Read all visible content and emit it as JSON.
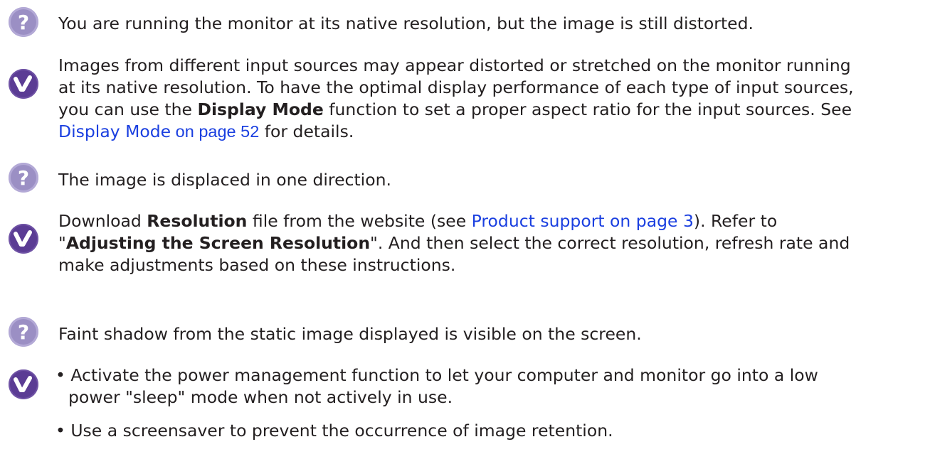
{
  "qa": [
    {
      "question": "You are running the monitor at its native resolution, but the image is still distorted.",
      "answer": {
        "line1": "Images from different input sources may appear distorted or stretched on the monitor running",
        "line2": "at its native resolution. To have the optimal display performance of each type of input sources,",
        "line3_pre": "you can use the ",
        "line3_bold": "Display Mode",
        "line3_post": " function to set a proper aspect ratio for the input sources. See",
        "link_text": "Display Mode",
        "link_page": " on page 52",
        "line4_post": " for details."
      }
    },
    {
      "question": "The image is displaced in one direction.",
      "answer": {
        "line1_pre": "Download ",
        "line1_bold": "Resolution",
        "line1_mid": " file from the website (see ",
        "link_text": "Product support on page 3",
        "line1_post": "). Refer to",
        "line2_pre": "\"",
        "line2_bold": "Adjusting the Screen Resolution",
        "line2_post": "\". And then select the correct resolution, refresh rate and",
        "line3": "make adjustments based on these instructions."
      }
    },
    {
      "question": "Faint shadow from the static image displayed is visible on the screen.",
      "answer": {
        "bullet": "•",
        "bullet1_line1": "Activate the power management function to let your computer and monitor go into a low",
        "bullet1_line2": "power \"sleep\" mode when not actively in use.",
        "bullet2": "Use a screensaver to prevent the occurrence of image retention."
      }
    }
  ],
  "colors": {
    "question_icon": "#9b8fc4",
    "answer_icon": "#5b3c94",
    "link": "#1a3fe0",
    "text": "#231f20"
  },
  "icons": {
    "question": "question-mark-icon",
    "answer": "checkmark-icon"
  }
}
